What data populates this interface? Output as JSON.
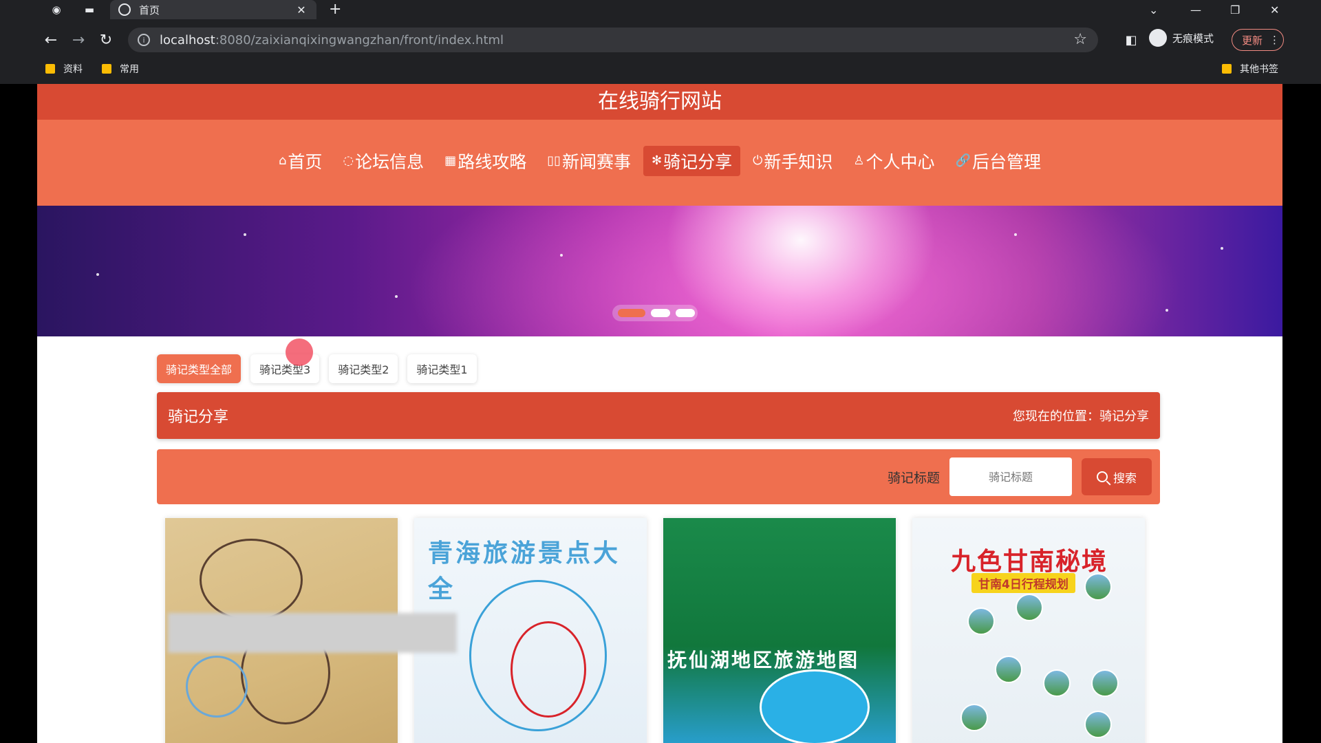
{
  "browser": {
    "tab_title": "首页",
    "url_host": "localhost",
    "url_path": ":8080/zaixianqixingwangzhan/front/index.html",
    "incognito_label": "无痕模式",
    "update_label": "更新",
    "bookmarks": [
      "资料",
      "常用"
    ],
    "other_bookmarks": "其他书签"
  },
  "site": {
    "title": "在线骑行网站",
    "nav": [
      {
        "label": "首页",
        "icon": "home-icon"
      },
      {
        "label": "论坛信息",
        "icon": "forum-icon"
      },
      {
        "label": "路线攻略",
        "icon": "grid-icon"
      },
      {
        "label": "新闻赛事",
        "icon": "news-icon"
      },
      {
        "label": "骑记分享",
        "icon": "share-icon"
      },
      {
        "label": "新手知识",
        "icon": "power-icon"
      },
      {
        "label": "个人中心",
        "icon": "user-icon"
      },
      {
        "label": "后台管理",
        "icon": "link-icon"
      }
    ],
    "active_nav": "骑记分享"
  },
  "filters": [
    "骑记类型全部",
    "骑记类型3",
    "骑记类型2",
    "骑记类型1"
  ],
  "section": {
    "title": "骑记分享",
    "breadcrumb": "您现在的位置：骑记分享"
  },
  "search": {
    "label": "骑记标题",
    "placeholder": "骑记标题",
    "button": "搜索"
  },
  "cards": [
    {
      "image": "map-route-image",
      "title": ""
    },
    {
      "image": "qinghai-map-image",
      "title": "青海旅游景点大全"
    },
    {
      "image": "fuxian-lake-map-image",
      "title": "抚仙湖地区旅游地图"
    },
    {
      "image": "gannan-poster-image",
      "title": "九色甘南秘境",
      "subtitle": "甘南4日行程规划"
    }
  ],
  "colors": {
    "primary": "#d84a33",
    "accent": "#ef6f4f"
  }
}
